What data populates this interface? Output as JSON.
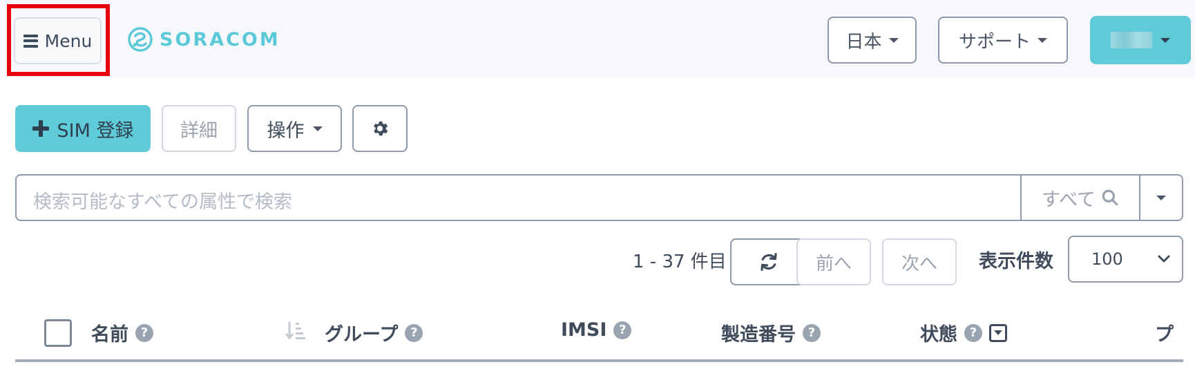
{
  "header": {
    "menu_label": "Menu",
    "logo_text": "SORACOM",
    "language_label": "日本",
    "support_label": "サポート",
    "accent_color": "#5fcad8",
    "highlight_color": "#e8000b"
  },
  "toolbar": {
    "sim_register_label": "SIM 登録",
    "details_label": "詳細",
    "operations_label": "操作",
    "settings_icon": "gear-icon"
  },
  "search": {
    "placeholder": "検索可能なすべての属性で検索",
    "scope_label": "すべて"
  },
  "pagination": {
    "range_text": "1 - 37 件目",
    "prev_label": "前へ",
    "next_label": "次へ",
    "per_page_label": "表示件数",
    "per_page_value": "100"
  },
  "table": {
    "columns": {
      "name": "名前",
      "group": "グループ",
      "imsi": "IMSI",
      "serial": "製造番号",
      "status": "状態",
      "truncated": "プ"
    }
  }
}
